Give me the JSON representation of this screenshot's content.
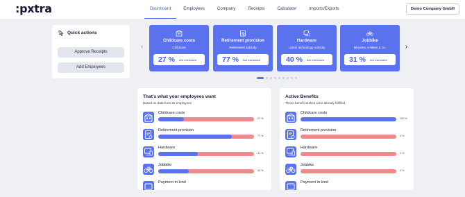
{
  "app": {
    "logo": ":pxtra"
  },
  "nav": {
    "items": [
      {
        "label": "Dashboard",
        "active": true
      },
      {
        "label": "Employees",
        "active": false
      },
      {
        "label": "Company",
        "active": false
      },
      {
        "label": "Receipts",
        "active": false
      },
      {
        "label": "Calculator",
        "active": false
      },
      {
        "label": "Imports/Exports",
        "active": false
      }
    ],
    "company_button": "Demo Company GmbH"
  },
  "quick_actions": {
    "title": "Quick actions",
    "buttons": [
      "Approve Receipts",
      "Add Employees"
    ]
  },
  "benefit_cards": [
    {
      "title": "Childcare costs",
      "subtitle": "Childcare",
      "percent": "27 %",
      "interested_label": "Are interested",
      "icon": "childcare-icon"
    },
    {
      "title": "Retirement provision",
      "subtitle": "Retirement subsidy",
      "percent": "77 %",
      "interested_label": "Are interested",
      "icon": "retirement-icon"
    },
    {
      "title": "Hardware",
      "subtitle": "Latest technology subsidy",
      "percent": "40 %",
      "interested_label": "Are interested",
      "icon": "hardware-icon"
    },
    {
      "title": "Jobbike",
      "subtitle": "Bicycles, e-bikes & co.",
      "percent": "31 %",
      "interested_label": "Are interested",
      "icon": "bike-icon"
    }
  ],
  "carousel": {
    "pages": 9,
    "active": 0
  },
  "wants_panel": {
    "title": "That's what your employees want",
    "subtitle": "Based on data from 22 employees",
    "rows": [
      {
        "label": "Childcare costs",
        "value": 27,
        "percent_label": "27 %",
        "icon": "childcare-icon"
      },
      {
        "label": "Retirement provision",
        "value": 77,
        "percent_label": "77 %",
        "icon": "retirement-icon"
      },
      {
        "label": "Hardware",
        "value": 41,
        "percent_label": "41 %",
        "icon": "hardware-icon"
      },
      {
        "label": "Jobbike",
        "value": 32,
        "percent_label": "32 %",
        "icon": "bike-icon"
      },
      {
        "label": "Payment in kind",
        "value": 0,
        "percent_label": "",
        "icon": "payment-icon"
      }
    ]
  },
  "active_panel": {
    "title": "Active Benefits",
    "subtitle": "These benefit wishes were already fulfilled",
    "rows": [
      {
        "label": "Childcare costs",
        "value": 100,
        "percent_label": "100 %",
        "icon": "childcare-icon"
      },
      {
        "label": "Retirement provision",
        "value": 0,
        "percent_label": "0 %",
        "icon": "retirement-icon"
      },
      {
        "label": "Hardware",
        "value": 0,
        "percent_label": "0 %",
        "icon": "hardware-icon"
      },
      {
        "label": "Jobbike",
        "value": 0,
        "percent_label": "0 %",
        "icon": "bike-icon"
      },
      {
        "label": "Payment in kind",
        "value": 0,
        "percent_label": "",
        "icon": "payment-icon"
      }
    ]
  },
  "colors": {
    "accent": "#5a72ee",
    "bar_empty": "#f08a8a",
    "background": "#eef0f4"
  }
}
